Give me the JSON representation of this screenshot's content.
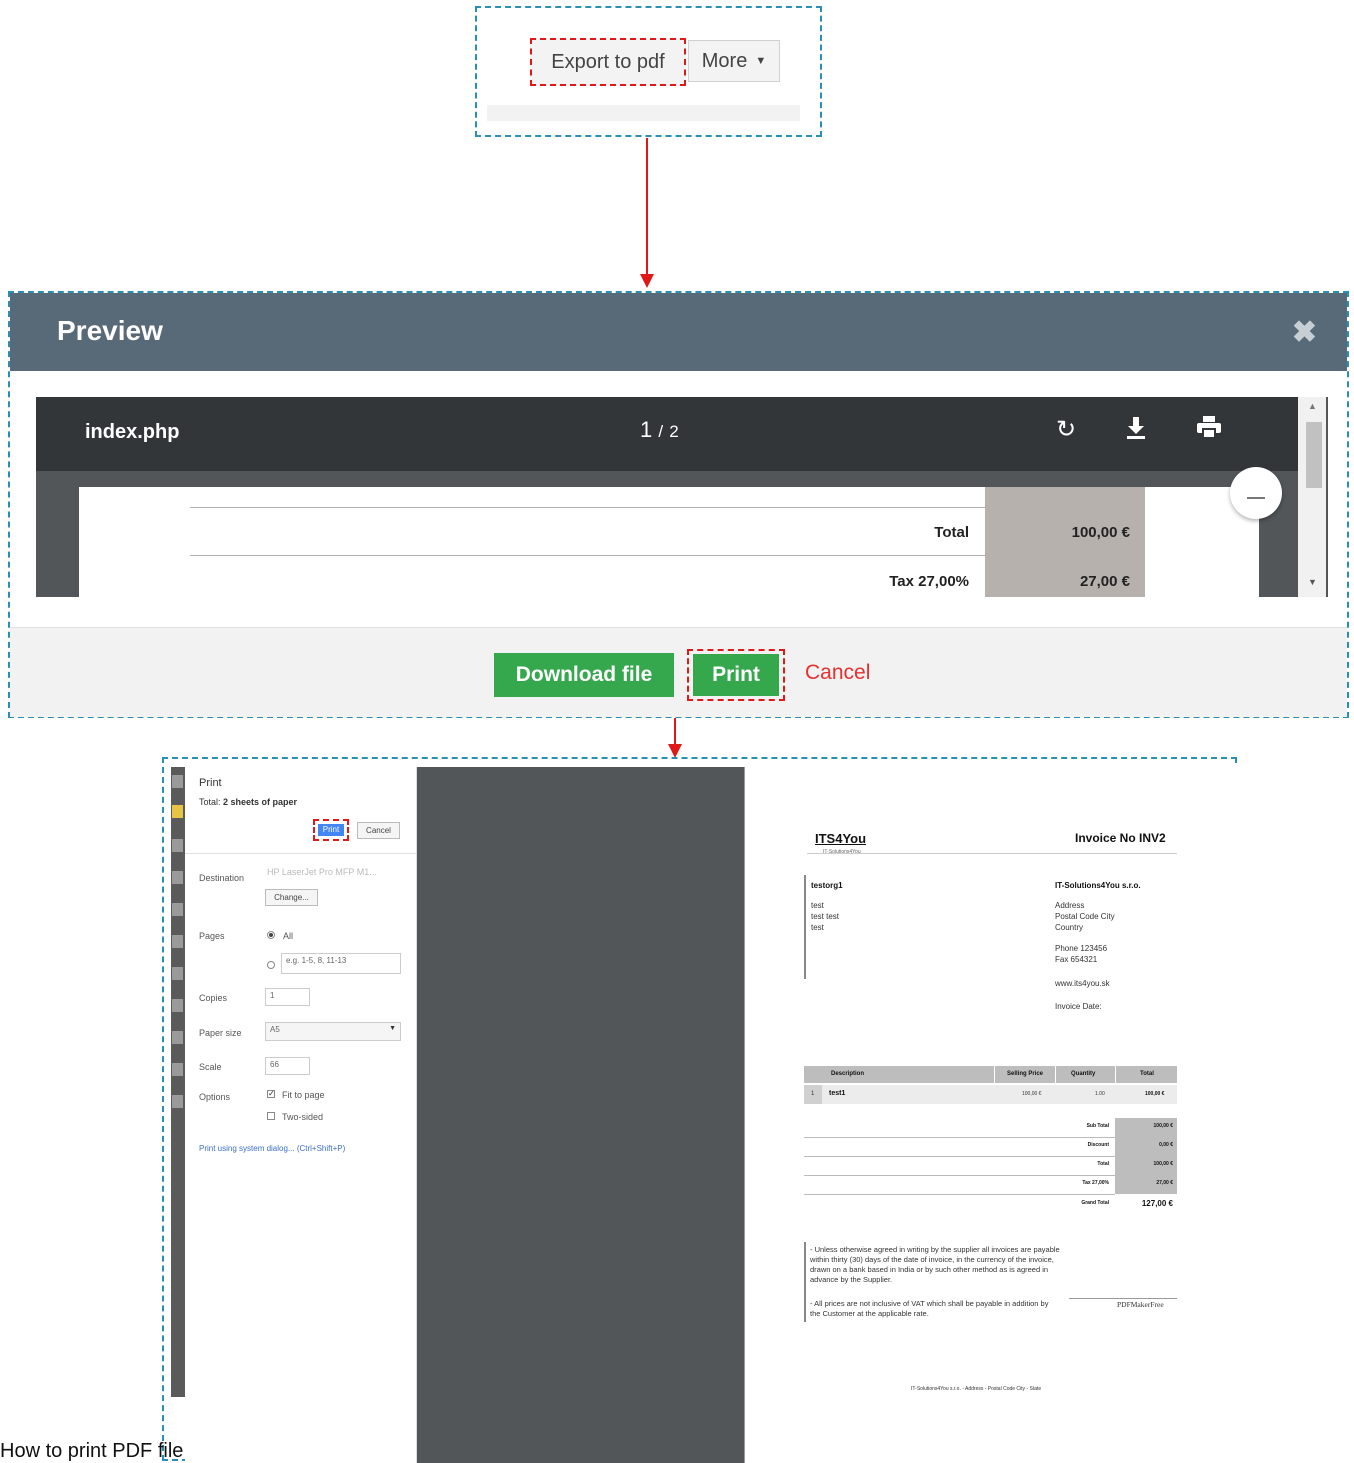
{
  "toolbar": {
    "export_label": "Export to pdf",
    "more_label": "More"
  },
  "modal": {
    "title": "Preview",
    "viewer": {
      "filename": "index.php",
      "current_page": "1",
      "page_sep": "/",
      "total_pages": "2",
      "rows": [
        {
          "label": "Total",
          "value": "100,00 €"
        },
        {
          "label": "Tax 27,00%",
          "value": "27,00 €"
        }
      ]
    },
    "download_label": "Download file",
    "print_label": "Print",
    "cancel_label": "Cancel"
  },
  "print_dialog": {
    "title": "Print",
    "total_prefix": "Total: ",
    "total_value": "2 sheets of paper",
    "print_label": "Print",
    "cancel_label": "Cancel",
    "destination_label": "Destination",
    "destination_value": "HP LaserJet Pro MFP M1...",
    "change_label": "Change...",
    "pages_label": "Pages",
    "pages_all": "All",
    "pages_placeholder": "e.g. 1-5, 8, 11-13",
    "copies_label": "Copies",
    "copies_value": "1",
    "paper_label": "Paper size",
    "paper_value": "A5",
    "scale_label": "Scale",
    "scale_value": "66",
    "options_label": "Options",
    "fit_label": "Fit to page",
    "twosided_label": "Two-sided",
    "system_dialog": "Print using system dialog... (Ctrl+Shift+P)"
  },
  "invoice": {
    "logo": "ITS4You",
    "logo_sub": "IT-Solutions4You",
    "title": "Invoice No INV2",
    "customer": "testorg1",
    "customer_lines": [
      "test",
      "test test",
      "test"
    ],
    "company": "IT-Solutions4You s.r.o.",
    "company_lines": [
      "Address",
      "Postal Code City",
      "Country",
      "",
      "Phone 123456",
      "Fax 654321",
      "",
      "www.its4you.sk",
      "",
      "Invoice Date:"
    ],
    "headers": [
      "Description",
      "Selling Price",
      "Quantity",
      "Total"
    ],
    "item": {
      "no": "1",
      "desc": "test1",
      "price": "100,00 €",
      "qty": "1.00",
      "total": "100,00 €"
    },
    "summary": [
      {
        "label": "Sub Total",
        "value": "100,00 €"
      },
      {
        "label": "Discount",
        "value": "0,00 €"
      },
      {
        "label": "Total",
        "value": "100,00 €"
      },
      {
        "label": "Tax 27,00%",
        "value": "27,00 €"
      }
    ],
    "grand_label": "Grand Total",
    "grand_value": "127,00 €",
    "terms1": "- Unless otherwise agreed in writing by the supplier all invoices are payable within thirty (30) days of the date of invoice, in the currency of the invoice, drawn on a bank based in India or by such other method as is agreed in advance by the Supplier.",
    "terms2": "- All prices are not inclusive of VAT which shall be payable in addition by the Customer at the applicable rate.",
    "signature": "PDFMakerFree",
    "footer": "IT-Solutions4You s.r.o. - Address - Postal Code City - State"
  },
  "caption": "How to print PDF file"
}
